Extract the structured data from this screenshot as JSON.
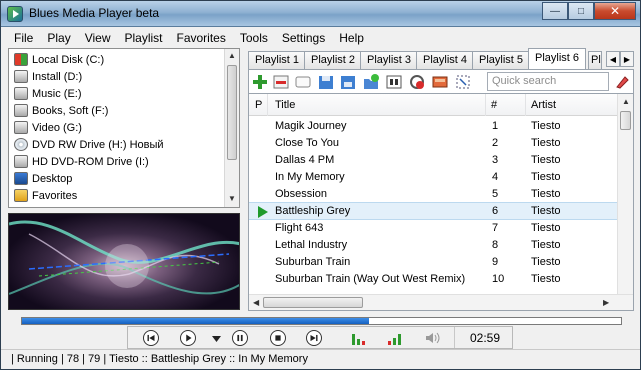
{
  "window": {
    "title": "Blues Media Player beta"
  },
  "menu": [
    "File",
    "Play",
    "View",
    "Playlist",
    "Favorites",
    "Tools",
    "Settings",
    "Help"
  ],
  "drives": [
    {
      "label": "Local Disk (C:)",
      "icon": "windows-drive-icon"
    },
    {
      "label": "Install (D:)",
      "icon": "hard-drive-icon"
    },
    {
      "label": "Music (E:)",
      "icon": "hard-drive-icon"
    },
    {
      "label": "Books, Soft (F:)",
      "icon": "hard-drive-icon"
    },
    {
      "label": "Video (G:)",
      "icon": "hard-drive-icon"
    },
    {
      "label": "DVD RW Drive (H:) Новый",
      "icon": "disc-drive-icon"
    },
    {
      "label": "HD DVD-ROM Drive (I:)",
      "icon": "disc-drive-icon"
    },
    {
      "label": "Desktop",
      "icon": "desktop-icon"
    },
    {
      "label": "Favorites",
      "icon": "favorites-icon"
    }
  ],
  "tabs": [
    "Playlist 1",
    "Playlist 2",
    "Playlist 3",
    "Playlist 4",
    "Playlist 5",
    "Playlist 6",
    "Pl"
  ],
  "active_tab": "Playlist 6",
  "search": {
    "placeholder": "Quick search"
  },
  "columns": {
    "p": "P",
    "title": "Title",
    "num": "#",
    "artist": "Artist"
  },
  "tracks": [
    {
      "title": "Magik Journey",
      "num": "1",
      "artist": "Tiesto"
    },
    {
      "title": "Close To You",
      "num": "2",
      "artist": "Tiesto"
    },
    {
      "title": "Dallas 4 PM",
      "num": "3",
      "artist": "Tiesto"
    },
    {
      "title": "In My Memory",
      "num": "4",
      "artist": "Tiesto"
    },
    {
      "title": "Obsession",
      "num": "5",
      "artist": "Tiesto"
    },
    {
      "title": "Battleship Grey",
      "num": "6",
      "artist": "Tiesto",
      "playing": true
    },
    {
      "title": "Flight 643",
      "num": "7",
      "artist": "Tiesto"
    },
    {
      "title": "Lethal Industry",
      "num": "8",
      "artist": "Tiesto"
    },
    {
      "title": "Suburban Train",
      "num": "9",
      "artist": "Tiesto"
    },
    {
      "title": "Suburban Train (Way Out West Remix)",
      "num": "10",
      "artist": "Tiesto"
    }
  ],
  "playback": {
    "progress": 0.58,
    "time": "02:59"
  },
  "status": "| Running | 78 | 79 | Tiesto :: Battleship Grey :: In My Memory",
  "colors": {
    "progress": "#1560c0",
    "play_marker": "#1f9a2c",
    "selected_row": "#e3f0fa"
  }
}
